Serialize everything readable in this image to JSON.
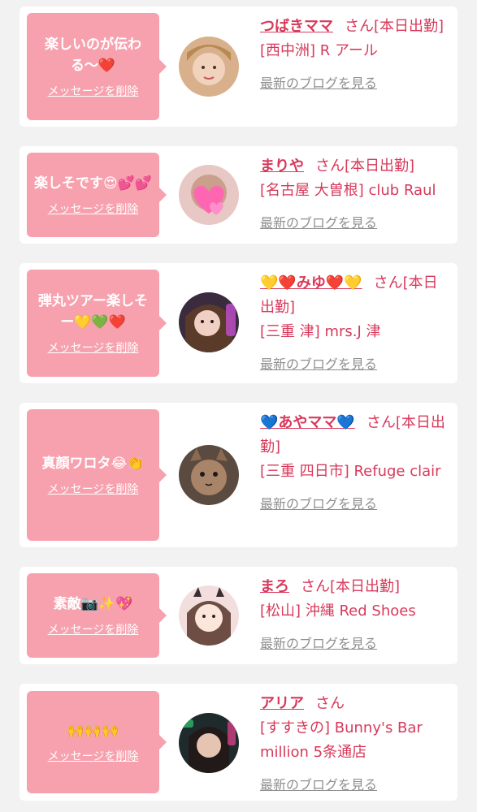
{
  "cards": [
    {
      "message": "楽しいのが伝わる〜❤️",
      "delete_label": "メッセージを削除",
      "name": "つばきママ",
      "suffix": "さん[本日出勤]",
      "shop": "[西中洲] R アール",
      "blog_label": "最新のブログを見る"
    },
    {
      "message": "楽しそです😍💕💕",
      "delete_label": "メッセージを削除",
      "name": "まりや",
      "suffix": "さん[本日出勤]",
      "shop": "[名古屋 大曽根] club Raul",
      "blog_label": "最新のブログを見る"
    },
    {
      "message": "弾丸ツアー楽しそー💛💚❤️",
      "delete_label": "メッセージを削除",
      "name": "💛❤️みゆ❤️💛",
      "suffix": "さん[本日出勤]",
      "shop": "[三重 津] mrs.J 津",
      "blog_label": "最新のブログを見る"
    },
    {
      "message": "真顔ワロタ😂👏",
      "delete_label": "メッセージを削除",
      "name": "💙あやママ💙",
      "suffix": "さん[本日出勤]",
      "shop": "[三重 四日市] Refuge clair",
      "blog_label": "最新のブログを見る"
    },
    {
      "message": "素敵📷✨💖",
      "delete_label": "メッセージを削除",
      "name": "まろ",
      "suffix": "さん[本日出勤]",
      "shop": "[松山] 沖縄 Red Shoes",
      "blog_label": "最新のブログを見る"
    },
    {
      "message": "🙌🙌🙌",
      "delete_label": "メッセージを削除",
      "name": "アリア",
      "suffix": "さん",
      "shop": "[すすきの] Bunny's Bar million 5条通店",
      "blog_label": "最新のブログを見る"
    }
  ],
  "colors": {
    "accent": "#d8395b",
    "bubble": "#f7a1ae",
    "link_gray": "#8f8f8f",
    "background": "#f2f2f2"
  }
}
